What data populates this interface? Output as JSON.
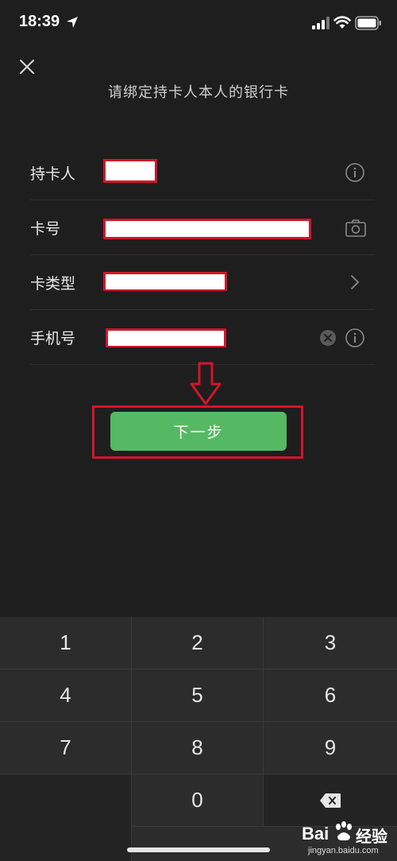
{
  "status": {
    "time": "18:39"
  },
  "header": {
    "subtitle": "请绑定持卡人本人的银行卡"
  },
  "form": {
    "holder_label": "持卡人",
    "card_label": "卡号",
    "type_label": "卡类型",
    "phone_label": "手机号"
  },
  "actions": {
    "next_label": "下一步"
  },
  "keypad": {
    "keys": [
      "1",
      "2",
      "3",
      "4",
      "5",
      "6",
      "7",
      "8",
      "9",
      "0"
    ]
  },
  "watermark": {
    "logo_text": "Bai",
    "brand": "经验",
    "site": "jingyan.baidu.com"
  },
  "colors": {
    "accent_green": "#55b964",
    "annotation_red": "#d3152a",
    "background": "#1e1e1e"
  }
}
